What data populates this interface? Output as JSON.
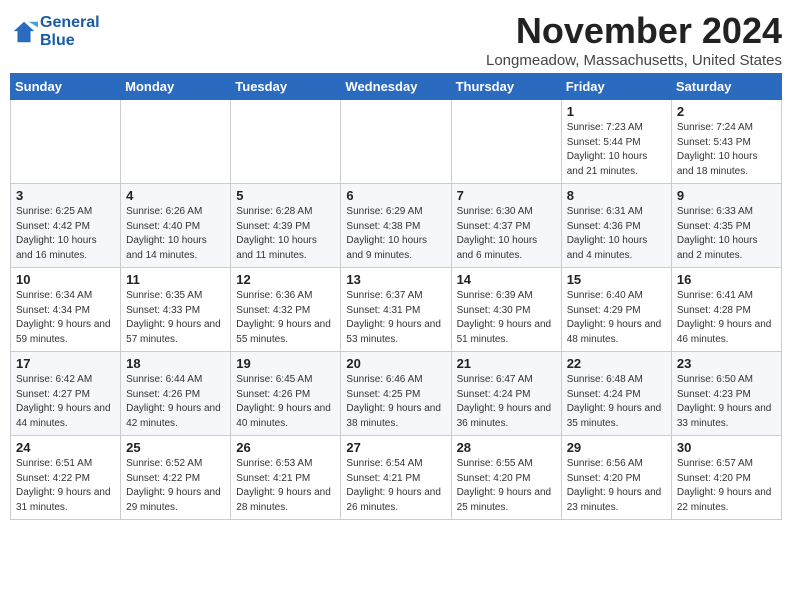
{
  "logo": {
    "line1": "General",
    "line2": "Blue"
  },
  "title": "November 2024",
  "location": "Longmeadow, Massachusetts, United States",
  "weekdays": [
    "Sunday",
    "Monday",
    "Tuesday",
    "Wednesday",
    "Thursday",
    "Friday",
    "Saturday"
  ],
  "weeks": [
    [
      {
        "day": "",
        "content": ""
      },
      {
        "day": "",
        "content": ""
      },
      {
        "day": "",
        "content": ""
      },
      {
        "day": "",
        "content": ""
      },
      {
        "day": "",
        "content": ""
      },
      {
        "day": "1",
        "content": "Sunrise: 7:23 AM\nSunset: 5:44 PM\nDaylight: 10 hours and 21 minutes."
      },
      {
        "day": "2",
        "content": "Sunrise: 7:24 AM\nSunset: 5:43 PM\nDaylight: 10 hours and 18 minutes."
      }
    ],
    [
      {
        "day": "3",
        "content": "Sunrise: 6:25 AM\nSunset: 4:42 PM\nDaylight: 10 hours and 16 minutes."
      },
      {
        "day": "4",
        "content": "Sunrise: 6:26 AM\nSunset: 4:40 PM\nDaylight: 10 hours and 14 minutes."
      },
      {
        "day": "5",
        "content": "Sunrise: 6:28 AM\nSunset: 4:39 PM\nDaylight: 10 hours and 11 minutes."
      },
      {
        "day": "6",
        "content": "Sunrise: 6:29 AM\nSunset: 4:38 PM\nDaylight: 10 hours and 9 minutes."
      },
      {
        "day": "7",
        "content": "Sunrise: 6:30 AM\nSunset: 4:37 PM\nDaylight: 10 hours and 6 minutes."
      },
      {
        "day": "8",
        "content": "Sunrise: 6:31 AM\nSunset: 4:36 PM\nDaylight: 10 hours and 4 minutes."
      },
      {
        "day": "9",
        "content": "Sunrise: 6:33 AM\nSunset: 4:35 PM\nDaylight: 10 hours and 2 minutes."
      }
    ],
    [
      {
        "day": "10",
        "content": "Sunrise: 6:34 AM\nSunset: 4:34 PM\nDaylight: 9 hours and 59 minutes."
      },
      {
        "day": "11",
        "content": "Sunrise: 6:35 AM\nSunset: 4:33 PM\nDaylight: 9 hours and 57 minutes."
      },
      {
        "day": "12",
        "content": "Sunrise: 6:36 AM\nSunset: 4:32 PM\nDaylight: 9 hours and 55 minutes."
      },
      {
        "day": "13",
        "content": "Sunrise: 6:37 AM\nSunset: 4:31 PM\nDaylight: 9 hours and 53 minutes."
      },
      {
        "day": "14",
        "content": "Sunrise: 6:39 AM\nSunset: 4:30 PM\nDaylight: 9 hours and 51 minutes."
      },
      {
        "day": "15",
        "content": "Sunrise: 6:40 AM\nSunset: 4:29 PM\nDaylight: 9 hours and 48 minutes."
      },
      {
        "day": "16",
        "content": "Sunrise: 6:41 AM\nSunset: 4:28 PM\nDaylight: 9 hours and 46 minutes."
      }
    ],
    [
      {
        "day": "17",
        "content": "Sunrise: 6:42 AM\nSunset: 4:27 PM\nDaylight: 9 hours and 44 minutes."
      },
      {
        "day": "18",
        "content": "Sunrise: 6:44 AM\nSunset: 4:26 PM\nDaylight: 9 hours and 42 minutes."
      },
      {
        "day": "19",
        "content": "Sunrise: 6:45 AM\nSunset: 4:26 PM\nDaylight: 9 hours and 40 minutes."
      },
      {
        "day": "20",
        "content": "Sunrise: 6:46 AM\nSunset: 4:25 PM\nDaylight: 9 hours and 38 minutes."
      },
      {
        "day": "21",
        "content": "Sunrise: 6:47 AM\nSunset: 4:24 PM\nDaylight: 9 hours and 36 minutes."
      },
      {
        "day": "22",
        "content": "Sunrise: 6:48 AM\nSunset: 4:24 PM\nDaylight: 9 hours and 35 minutes."
      },
      {
        "day": "23",
        "content": "Sunrise: 6:50 AM\nSunset: 4:23 PM\nDaylight: 9 hours and 33 minutes."
      }
    ],
    [
      {
        "day": "24",
        "content": "Sunrise: 6:51 AM\nSunset: 4:22 PM\nDaylight: 9 hours and 31 minutes."
      },
      {
        "day": "25",
        "content": "Sunrise: 6:52 AM\nSunset: 4:22 PM\nDaylight: 9 hours and 29 minutes."
      },
      {
        "day": "26",
        "content": "Sunrise: 6:53 AM\nSunset: 4:21 PM\nDaylight: 9 hours and 28 minutes."
      },
      {
        "day": "27",
        "content": "Sunrise: 6:54 AM\nSunset: 4:21 PM\nDaylight: 9 hours and 26 minutes."
      },
      {
        "day": "28",
        "content": "Sunrise: 6:55 AM\nSunset: 4:20 PM\nDaylight: 9 hours and 25 minutes."
      },
      {
        "day": "29",
        "content": "Sunrise: 6:56 AM\nSunset: 4:20 PM\nDaylight: 9 hours and 23 minutes."
      },
      {
        "day": "30",
        "content": "Sunrise: 6:57 AM\nSunset: 4:20 PM\nDaylight: 9 hours and 22 minutes."
      }
    ]
  ]
}
